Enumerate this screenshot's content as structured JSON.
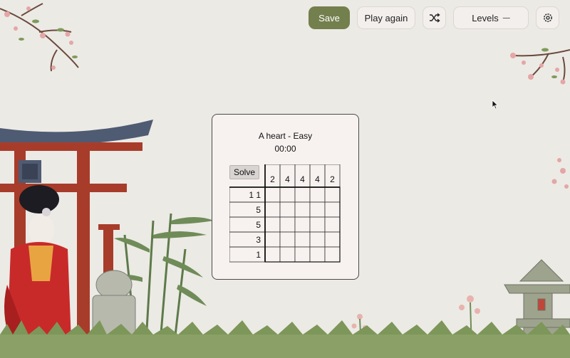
{
  "toolbar": {
    "save_label": "Save",
    "play_again_label": "Play again",
    "shuffle_icon": "shuffle-icon",
    "levels_label": "Levels",
    "levels_icon": "chevron-down-icon",
    "settings_icon": "gear-icon"
  },
  "puzzle": {
    "title": "A heart - Easy",
    "timer": "00:00",
    "solve_label": "Solve",
    "column_clues": [
      "2",
      "4",
      "4",
      "4",
      "2"
    ],
    "row_clues": [
      "1  1",
      "5",
      "5",
      "3",
      "1"
    ],
    "cells": [
      [
        0,
        0,
        0,
        0,
        0
      ],
      [
        0,
        0,
        0,
        0,
        0
      ],
      [
        0,
        0,
        0,
        0,
        0
      ],
      [
        0,
        0,
        0,
        0,
        0
      ],
      [
        0,
        0,
        0,
        0,
        0
      ]
    ]
  },
  "colors": {
    "save_button": "#737f4d",
    "background": "#eceae5",
    "torii_red": "#a83c2a",
    "torii_roof": "#4f5b72",
    "kimono_red": "#c82a2a",
    "blossom_pink": "#e4a6a6",
    "bamboo_green": "#5d7a4a"
  }
}
